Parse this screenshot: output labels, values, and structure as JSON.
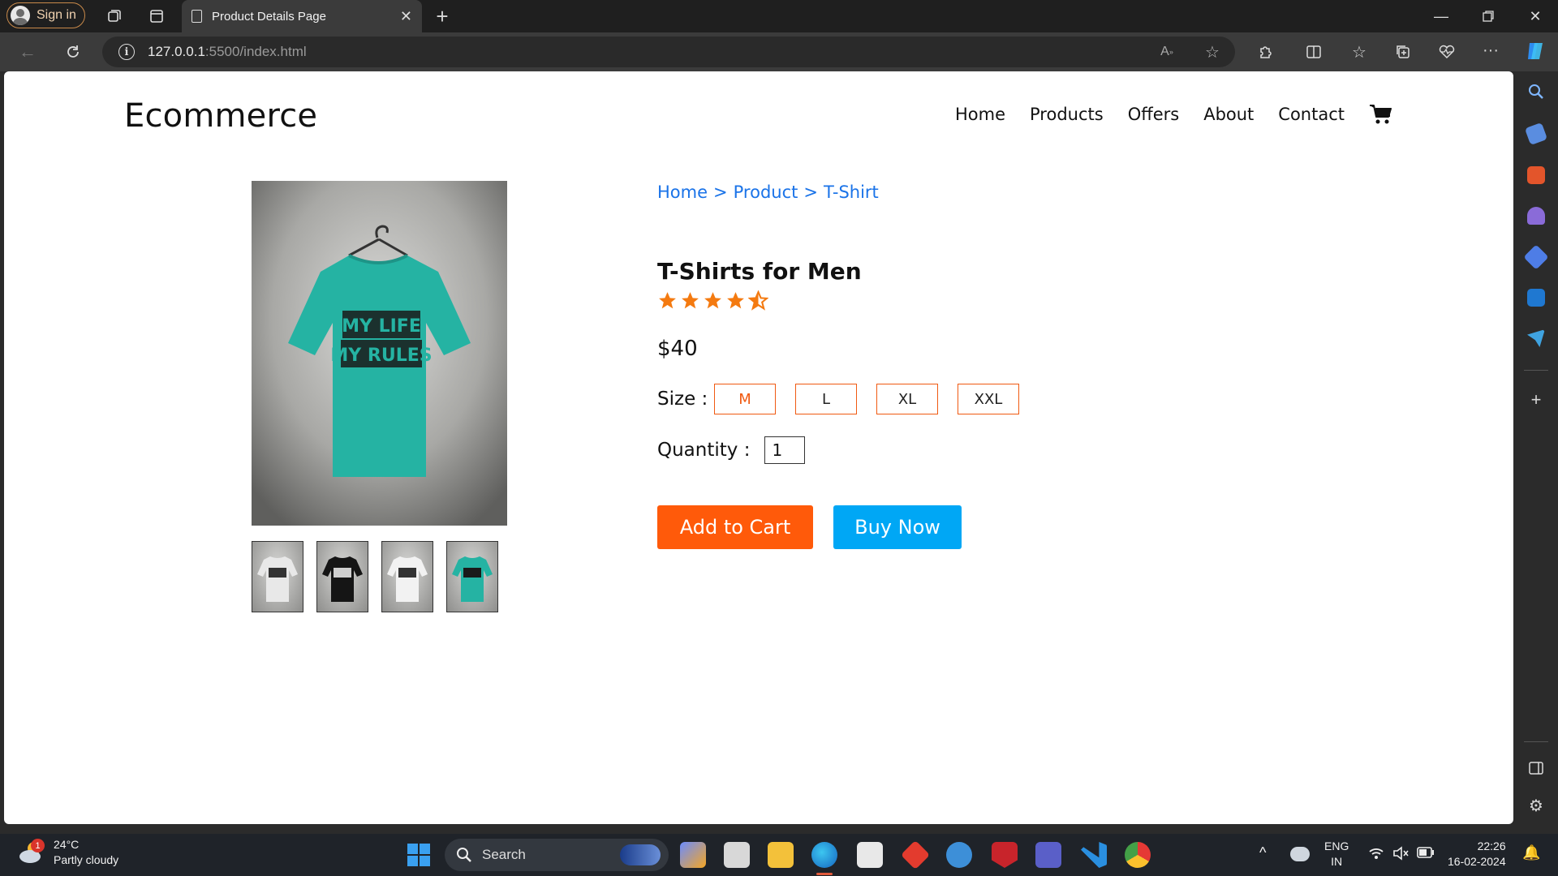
{
  "browser": {
    "signin_label": "Sign in",
    "tab_title": "Product Details Page",
    "url_host": "127.0.0.1",
    "url_path": ":5500/index.html"
  },
  "site": {
    "brand": "Ecommerce",
    "nav": [
      "Home",
      "Products",
      "Offers",
      "About",
      "Contact"
    ]
  },
  "product": {
    "breadcrumb": [
      "Home",
      "Product",
      "T-Shirt"
    ],
    "breadcrumb_sep": ">",
    "title": "T-Shirts for Men",
    "rating": 4.5,
    "price": "$40",
    "size_label": "Size :",
    "sizes": [
      "M",
      "L",
      "XL",
      "XXL"
    ],
    "selected_size": "M",
    "quantity_label": "Quantity :",
    "quantity": "1",
    "shirt_text": [
      "MY LIFE",
      "MY RULES"
    ],
    "thumbnails": [
      "white-tshirt",
      "black-tshirt",
      "white-tshirt",
      "teal-tshirt"
    ],
    "add_to_cart": "Add to Cart",
    "buy_now": "Buy Now"
  },
  "taskbar": {
    "weather_temp": "24°C",
    "weather_desc": "Partly cloudy",
    "weather_badge": "1",
    "search_label": "Search",
    "lang_top": "ENG",
    "lang_bottom": "IN",
    "time": "22:26",
    "date": "16-02-2024"
  },
  "colors": {
    "accent_orange": "#ff5a0a",
    "buy_blue": "#00a7f5",
    "link_blue": "#1a73e8",
    "shirt_teal": "#25b3a3",
    "star_orange": "#f47a10"
  }
}
